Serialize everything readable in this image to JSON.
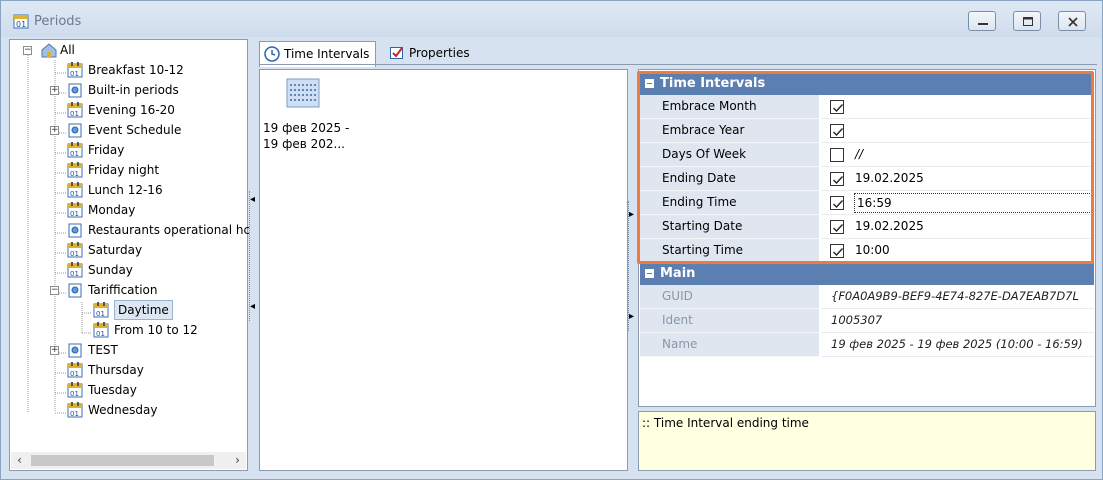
{
  "window": {
    "title": "Periods"
  },
  "tree": {
    "root": "All",
    "items": [
      {
        "label": "Breakfast 10-12",
        "type": "calendar",
        "expander": ""
      },
      {
        "label": "Built-in periods",
        "type": "folder",
        "expander": "+"
      },
      {
        "label": "Evening 16-20",
        "type": "calendar",
        "expander": ""
      },
      {
        "label": "Event Schedule",
        "type": "folder",
        "expander": "+"
      },
      {
        "label": "Friday",
        "type": "calendar",
        "expander": ""
      },
      {
        "label": "Friday night",
        "type": "calendar",
        "expander": ""
      },
      {
        "label": "Lunch 12-16",
        "type": "calendar",
        "expander": ""
      },
      {
        "label": "Monday",
        "type": "calendar",
        "expander": ""
      },
      {
        "label": "Restaurants operational hc",
        "type": "folder",
        "expander": ""
      },
      {
        "label": "Saturday",
        "type": "calendar",
        "expander": ""
      },
      {
        "label": "Sunday",
        "type": "calendar",
        "expander": ""
      },
      {
        "label": "Tariffication",
        "type": "folder",
        "expander": "-"
      },
      {
        "label": "Daytime",
        "type": "calendar",
        "expander": "",
        "child": true,
        "selected": true
      },
      {
        "label": "From 10 to 12",
        "type": "calendar",
        "expander": "",
        "child": true
      },
      {
        "label": "TEST",
        "type": "folder",
        "expander": "+"
      },
      {
        "label": "Thursday",
        "type": "calendar",
        "expander": ""
      },
      {
        "label": "Tuesday",
        "type": "calendar",
        "expander": ""
      },
      {
        "label": "Wednesday",
        "type": "calendar",
        "expander": ""
      }
    ]
  },
  "tabs": [
    {
      "label": "Time Intervals",
      "icon": "clock-icon",
      "active": true
    },
    {
      "label": "Properties",
      "icon": "properties-icon",
      "active": false
    }
  ],
  "item_view": {
    "caption_line1": "19 фев 2025 -",
    "caption_line2": "19 фев 202..."
  },
  "property_grid": {
    "time_intervals": {
      "label": "Time Intervals",
      "rows": [
        {
          "name": "Embrace Month",
          "checked": true,
          "value": ""
        },
        {
          "name": "Embrace Year",
          "checked": true,
          "value": ""
        },
        {
          "name": "Days Of Week",
          "checked": false,
          "value": "//"
        },
        {
          "name": "Ending Date",
          "checked": true,
          "value": "19.02.2025"
        },
        {
          "name": "Ending Time",
          "checked": true,
          "value": "16:59"
        },
        {
          "name": "Starting Date",
          "checked": true,
          "value": "19.02.2025"
        },
        {
          "name": "Starting Time",
          "checked": true,
          "value": "10:00"
        }
      ]
    },
    "main": {
      "label": "Main",
      "rows": [
        {
          "name": "GUID",
          "value": "{F0A0A9B9-BEF9-4E74-827E-DA7EAB7D7L"
        },
        {
          "name": "Ident",
          "value": "1005307"
        },
        {
          "name": "Name",
          "value": "19 фев 2025 - 19 фев 2025 (10:00 - 16:59)"
        }
      ]
    }
  },
  "description": {
    "text": ":: Time Interval ending time"
  },
  "colors": {
    "category_header": "#5b7fb0",
    "highlight_border": "#f07a3c",
    "description_bg": "#ffffe1"
  }
}
